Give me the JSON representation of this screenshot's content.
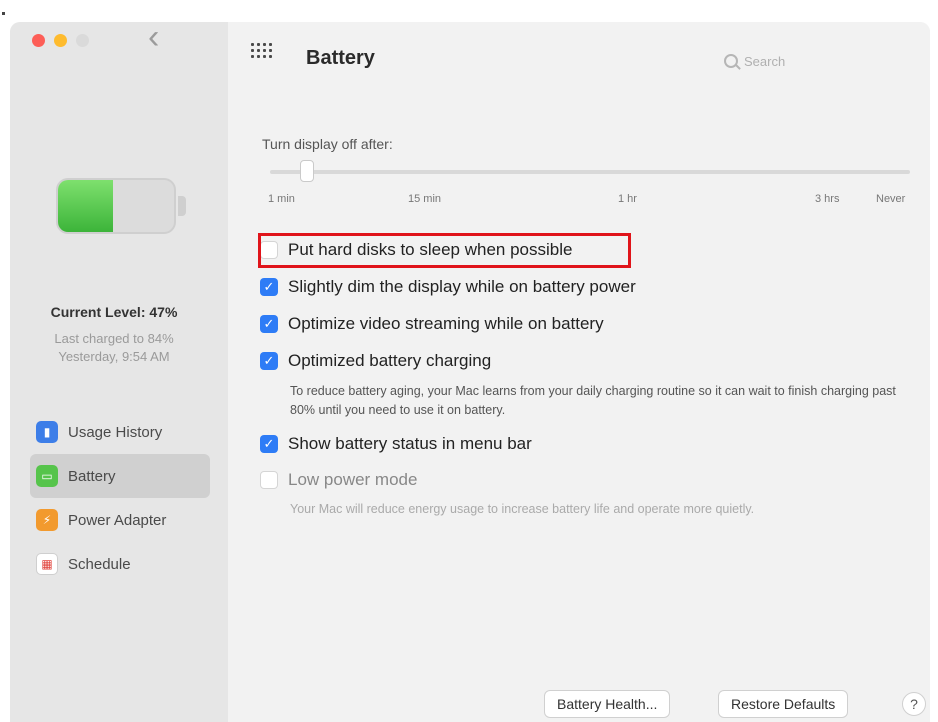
{
  "window": {
    "title": "Battery",
    "back_symbol": "‹"
  },
  "search": {
    "placeholder": "Search"
  },
  "sidebar": {
    "battery_level_fraction": 0.47,
    "current_level": "Current Level: 47%",
    "charge_info": "Last charged to 84%",
    "charge_time": "Yesterday, 9:54 AM",
    "items": [
      {
        "label": "Usage History",
        "icon": "chart-icon"
      },
      {
        "label": "Battery",
        "icon": "battery-icon"
      },
      {
        "label": "Power Adapter",
        "icon": "power-adapter-icon"
      },
      {
        "label": "Schedule",
        "icon": "calendar-icon"
      }
    ]
  },
  "display_sleep": {
    "label": "Turn display off after:",
    "ticks": [
      "1 min",
      "15 min",
      "1 hr",
      "3 hrs",
      "Never"
    ]
  },
  "options": {
    "hard_disks": {
      "label": "Put hard disks to sleep when possible",
      "checked": false
    },
    "dim_display": {
      "label": "Slightly dim the display while on battery power",
      "checked": true
    },
    "video_streaming": {
      "label": "Optimize video streaming while on battery",
      "checked": true
    },
    "optimized_charging": {
      "label": "Optimized battery charging",
      "checked": true,
      "description": "To reduce battery aging, your Mac learns from your daily charging routine so it can wait to finish charging past 80% until you need to use it on battery."
    },
    "menu_bar": {
      "label": "Show battery status in menu bar",
      "checked": true
    },
    "low_power": {
      "label": "Low power mode",
      "checked": false,
      "description": "Your Mac will reduce energy usage to increase battery life and operate more quietly."
    }
  },
  "buttons": {
    "battery_health": "Battery Health...",
    "restore_defaults": "Restore Defaults",
    "help": "?"
  },
  "colors": {
    "accent": "#2e7cf6",
    "highlight": "#e0141a",
    "battery_green": "#56c44b"
  }
}
